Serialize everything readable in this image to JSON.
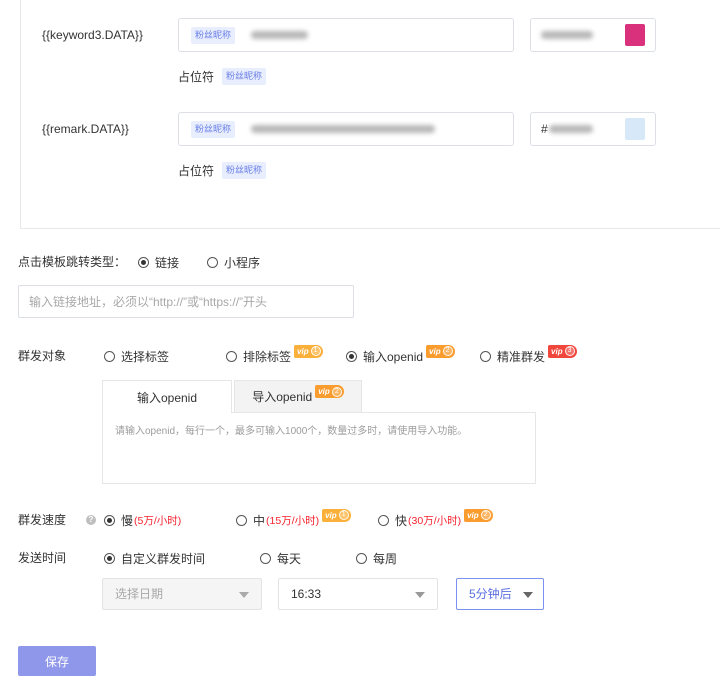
{
  "template_fields": [
    {
      "label": "{{keyword3.DATA}}",
      "value_tag": "粉丝昵称",
      "color_prefix": "",
      "swatch_color": "#d9317b",
      "placeholder_label": "占位符",
      "placeholder_tag": "粉丝昵称"
    },
    {
      "label": "{{remark.DATA}}",
      "value_tag": "粉丝昵称",
      "color_prefix": "#",
      "swatch_color": "#d7e8f8",
      "placeholder_label": "占位符",
      "placeholder_tag": "粉丝昵称"
    }
  ],
  "jump_type": {
    "label": "点击模板跳转类型：",
    "options": [
      {
        "label": "链接",
        "checked": true
      },
      {
        "label": "小程序",
        "checked": false
      }
    ],
    "url_input": {
      "value": "",
      "placeholder": "输入链接地址，必须以“http://”或“https://”开头"
    }
  },
  "audience": {
    "label": "群发对象",
    "options": [
      {
        "label": "选择标签",
        "checked": false
      },
      {
        "label": "排除标签",
        "checked": false,
        "badge": {
          "label": "vip",
          "level": "1",
          "color": "#fbb03b"
        }
      },
      {
        "label": "输入openid",
        "checked": true,
        "badge": {
          "label": "vip",
          "level": "2",
          "color": "#fa9c2e"
        }
      },
      {
        "label": "精准群发",
        "checked": false,
        "badge": {
          "label": "vip",
          "level": "3",
          "color": "#f0463c"
        }
      }
    ],
    "tabs": [
      {
        "label": "输入openid",
        "active": true
      },
      {
        "label": "导入openid",
        "active": false,
        "badge": {
          "label": "vip",
          "level": "2",
          "color": "#fa9c2e"
        }
      }
    ],
    "openid_textarea": {
      "value": "",
      "placeholder": "请输入openid，每行一个，最多可输入1000个，数量过多时，请使用导入功能。"
    }
  },
  "speed": {
    "label": "群发速度",
    "help_icon": "question-circle-icon",
    "options": [
      {
        "label": "慢",
        "rate": "(5万/小时)",
        "checked": true
      },
      {
        "label": "中",
        "rate": "(15万/小时)",
        "checked": false,
        "badge": {
          "label": "vip",
          "level": "1",
          "color": "#fbb03b"
        }
      },
      {
        "label": "快",
        "rate": "(30万/小时)",
        "checked": false,
        "badge": {
          "label": "vip",
          "level": "2",
          "color": "#fa9c2e"
        }
      }
    ]
  },
  "send_time": {
    "label": "发送时间",
    "options": [
      {
        "label": "自定义群发时间",
        "checked": true
      },
      {
        "label": "每天",
        "checked": false
      },
      {
        "label": "每周",
        "checked": false
      }
    ],
    "date_select": {
      "value": "",
      "placeholder": "选择日期"
    },
    "time_select": {
      "value": "16:33"
    },
    "delay_select": {
      "value": "5分钟后"
    }
  },
  "save_label": "保存",
  "colors": {
    "accent": "#5b6fe0",
    "button": "#8e97ea",
    "rate_text": "#f5222d",
    "tag_text": "#6b80e6",
    "tag_bg": "#e8eefe"
  }
}
